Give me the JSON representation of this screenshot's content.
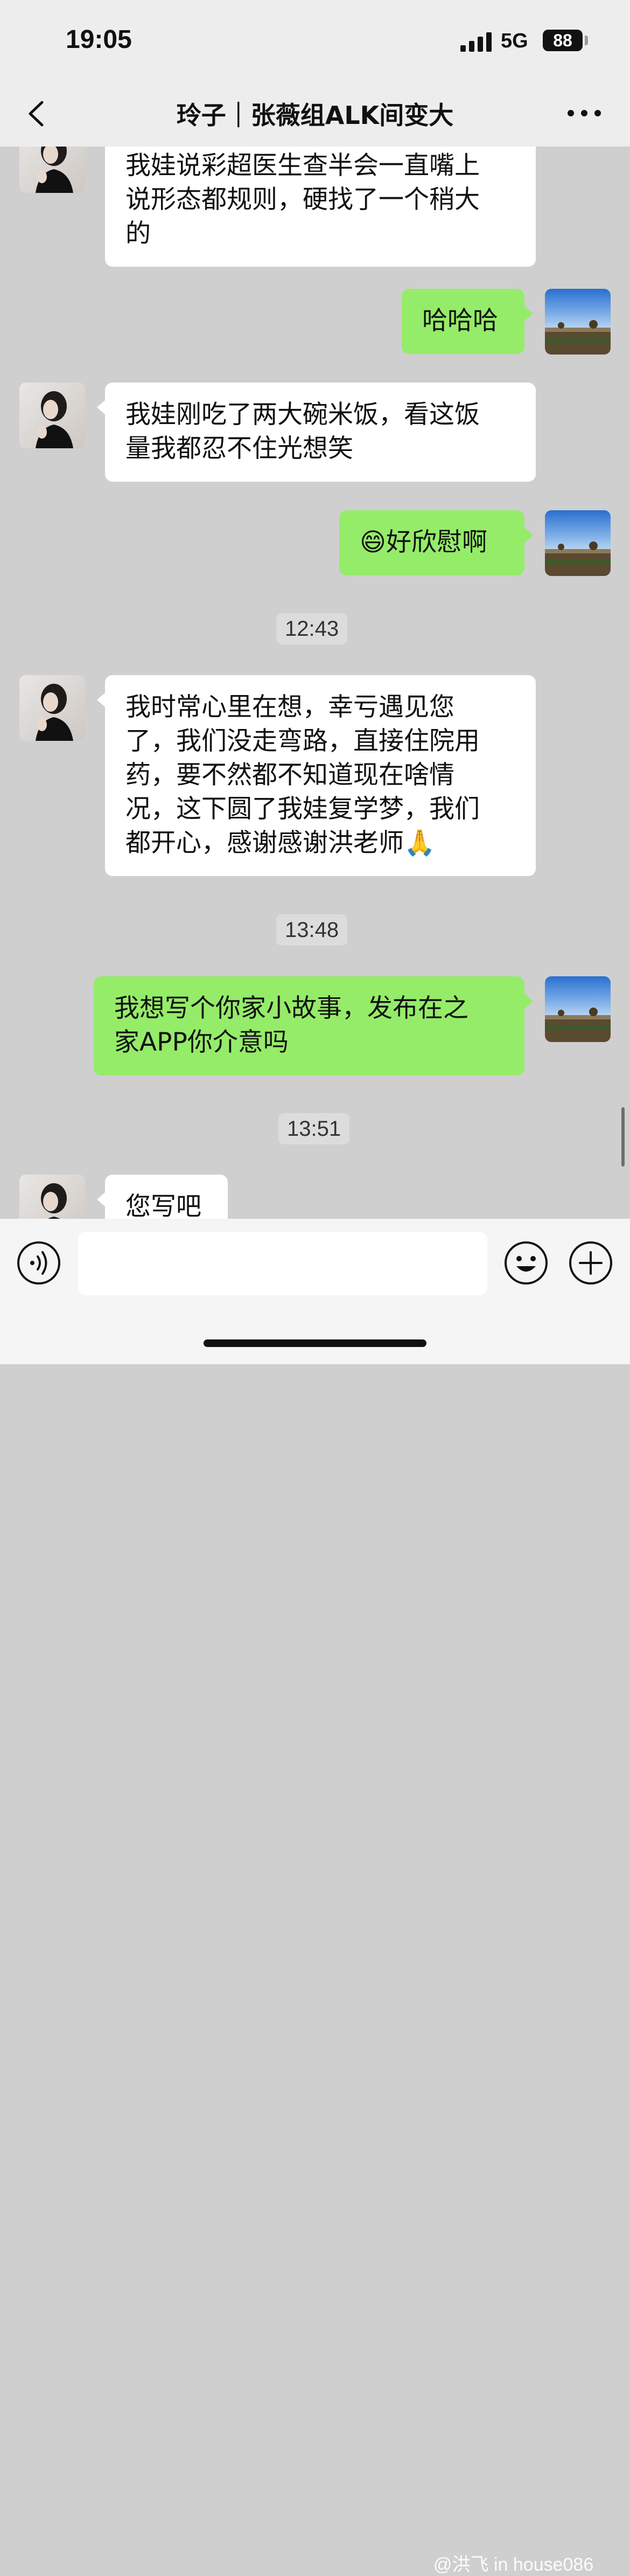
{
  "status_bar": {
    "time": "19:05",
    "network": "5G",
    "battery": "88"
  },
  "header": {
    "title": "玲子｜张薇组ALK间变大"
  },
  "timestamps": [
    "12:43",
    "13:48",
    "13:51"
  ],
  "messages": [
    {
      "sender": "other",
      "lines": [
        "我娃说彩超医生查半会一直嘴上",
        "说形态都规则，硬找了一个稍大",
        "的"
      ]
    },
    {
      "sender": "me",
      "lines": [
        "哈哈哈"
      ]
    },
    {
      "sender": "other",
      "lines": [
        "我娃刚吃了两大碗米饭，看这饭",
        "量我都忍不住光想笑"
      ]
    },
    {
      "sender": "me",
      "emoji": "😄",
      "lines": [
        "好欣慰啊"
      ]
    },
    {
      "sender": "other",
      "lines": [
        "我时常心里在想，幸亏遇见您",
        "了，我们没走弯路，直接住院用",
        "药，要不然都不知道现在啥情",
        "况，这下圆了我娃复学梦，我们",
        "都开心，感谢感谢洪老师🙏"
      ]
    },
    {
      "sender": "me",
      "lines": [
        "我想写个你家小故事，发布在之",
        "家APP你介意吗"
      ]
    },
    {
      "sender": "other",
      "lines": [
        "您写吧"
      ]
    }
  ],
  "input": {
    "placeholder": ""
  },
  "icons": {
    "back": "chevron-left-icon",
    "more": "more-horizontal-icon",
    "voice": "voice-icon",
    "emoji": "emoji-icon",
    "plus": "plus-circle-icon"
  },
  "colors": {
    "outgoing_bubble": "#95ec69",
    "incoming_bubble": "#ffffff",
    "chat_background": "#cfcfcf"
  },
  "watermark": "@洪飞 in house086"
}
